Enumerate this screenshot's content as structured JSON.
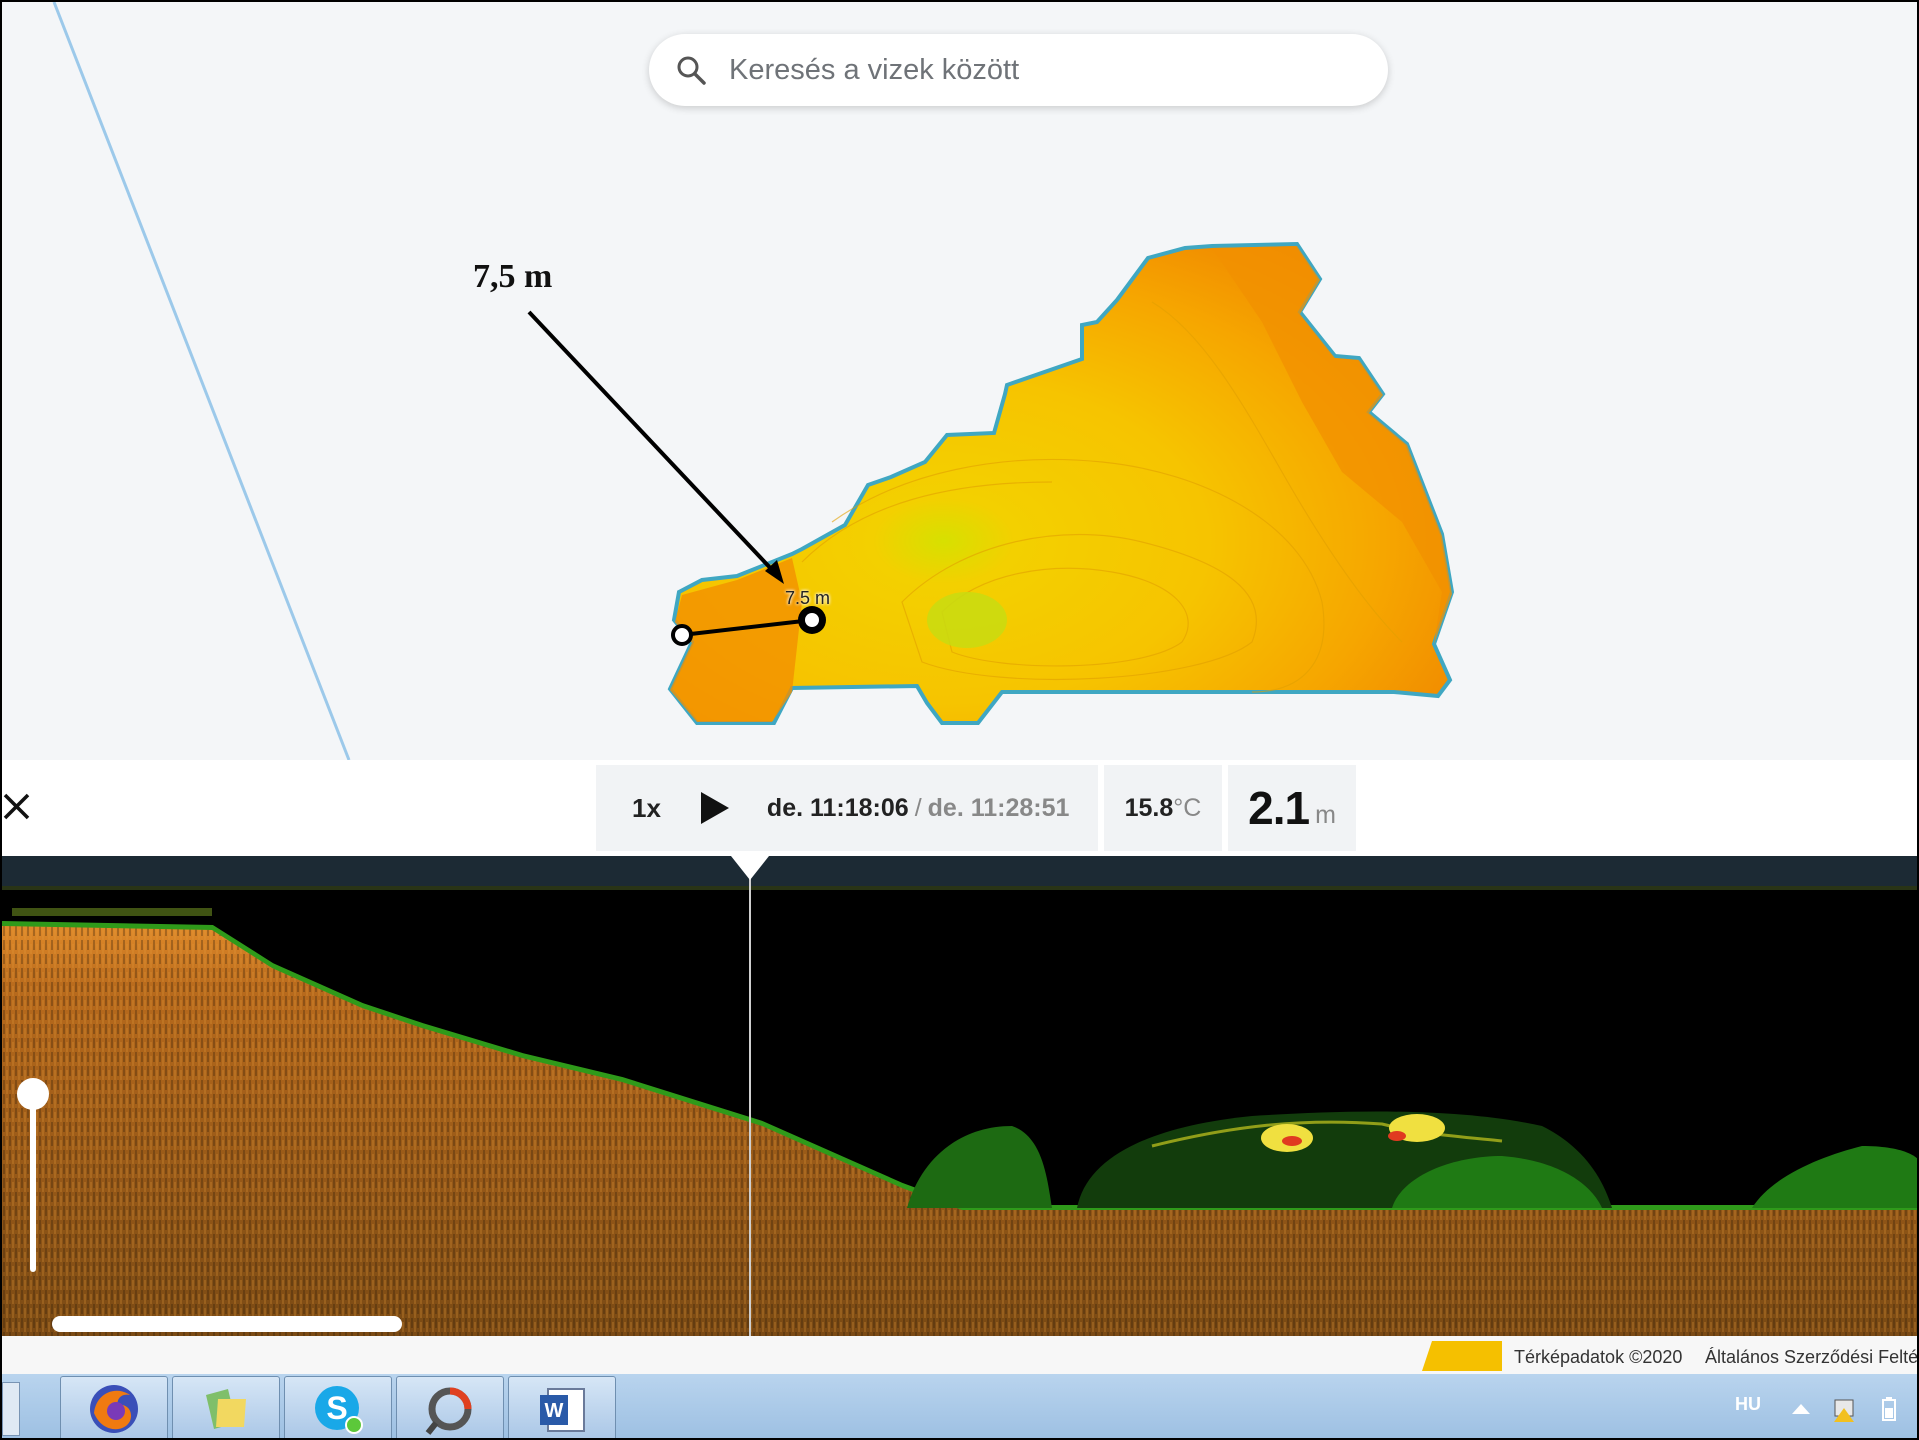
{
  "map": {
    "search": {
      "placeholder": "Keresés a vizek között",
      "icon": "search-icon"
    },
    "callout_label": "7,5 m",
    "measure_label": "7.5 m",
    "colors": {
      "shallow": "#f5d000",
      "mid": "#f8b400",
      "deep": "#f08a00",
      "shore": "#3fa7c2",
      "road": "#9cc9ea"
    }
  },
  "playback": {
    "close_icon": "close-icon",
    "speed": "1x",
    "play_icon": "play-icon",
    "time_current": "de. 11:18:06",
    "time_separator": "/",
    "time_end": "de. 11:28:51",
    "temperature_value": "15.8",
    "temperature_unit": "°C",
    "depth_value": "2.1",
    "depth_unit": "m"
  },
  "sonar": {
    "colors": {
      "bottom": "#c8741c",
      "vegetation": "#2a8a1a",
      "highlight": "#f0e040",
      "background": "#000000"
    }
  },
  "attribution": {
    "map_data": "Térképadatok ©2020",
    "terms": "Általános Szerződési Feltételek"
  },
  "taskbar": {
    "apps": [
      "firefox-icon",
      "folder-icon",
      "skype-icon",
      "app-icon",
      "word-icon"
    ],
    "language": "HU"
  }
}
